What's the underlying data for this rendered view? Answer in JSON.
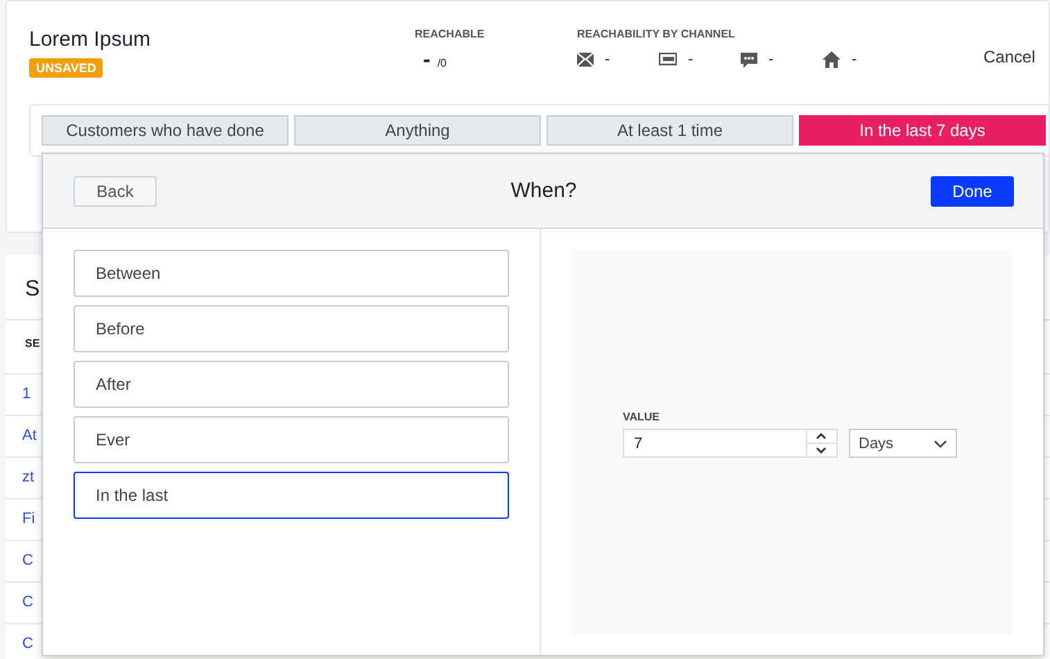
{
  "header": {
    "title": "Lorem Ipsum",
    "badge": "UNSAVED",
    "reachable": {
      "label": "REACHABLE",
      "value": "-",
      "total": "/0"
    },
    "channels_label": "REACHABILITY BY CHANNEL",
    "channels": [
      {
        "kind": "email",
        "value": "-"
      },
      {
        "kind": "screen",
        "value": "-"
      },
      {
        "kind": "chat",
        "value": "-"
      },
      {
        "kind": "home",
        "value": "-"
      }
    ],
    "cancel": "Cancel"
  },
  "filter_chips": [
    {
      "label": "Customers who have done",
      "selected": false
    },
    {
      "label": "Anything",
      "selected": false
    },
    {
      "label": "At least 1 time",
      "selected": false
    },
    {
      "label": "In the last 7 days",
      "selected": true
    }
  ],
  "background_list": {
    "heading": "S",
    "column": "SE",
    "rows": [
      "1",
      "At",
      "zt",
      "Fi",
      "C",
      "C",
      "C"
    ]
  },
  "modal": {
    "back": "Back",
    "title": "When?",
    "done": "Done",
    "options": [
      {
        "label": "Between",
        "selected": false
      },
      {
        "label": "Before",
        "selected": false
      },
      {
        "label": "After",
        "selected": false
      },
      {
        "label": "Ever",
        "selected": false
      },
      {
        "label": "In the last",
        "selected": true
      }
    ],
    "value_label": "VALUE",
    "value": "7",
    "unit": "Days"
  }
}
